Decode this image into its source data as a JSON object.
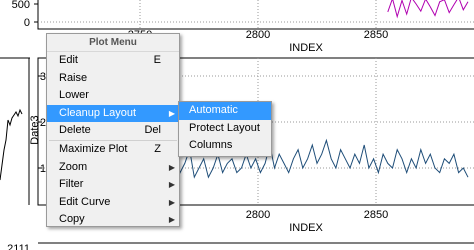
{
  "plots": {
    "top": {
      "y_ticks": [
        "500",
        "0"
      ],
      "x_ticks": [
        "2750",
        "2800",
        "2850"
      ],
      "x_label": "INDEX"
    },
    "bottom": {
      "y_ticks": [
        "3",
        "2",
        "1"
      ],
      "y_label": "Date3",
      "x_ticks": [
        "2800",
        "2850"
      ],
      "x_label": "INDEX"
    },
    "bottom_edge_label": "2111"
  },
  "colors": {
    "top_series": "#b000b0",
    "bottom_series": "#1f4e79",
    "left_series": "#000000",
    "menu_highlight": "#3399ff"
  },
  "chart_data": [
    {
      "type": "line",
      "xlabel": "INDEX",
      "ylabel": "",
      "ylim": [
        0,
        700
      ],
      "x_ticks": [
        2750,
        2800,
        2850
      ],
      "series": [
        {
          "x": [
            2855,
            2857,
            2859,
            2861,
            2863,
            2865,
            2867,
            2869,
            2871,
            2873,
            2875,
            2877,
            2879,
            2881,
            2883,
            2885,
            2887,
            2889
          ],
          "values": [
            280,
            650,
            150,
            600,
            220,
            680,
            500,
            300,
            640,
            420,
            180,
            560,
            620,
            260,
            480,
            690,
            340,
            560
          ]
        }
      ],
      "grid": true
    },
    {
      "type": "line",
      "xlabel": "INDEX",
      "ylabel": "Date3",
      "ylim": [
        0.5,
        3.5
      ],
      "x_ticks": [
        2800,
        2850
      ],
      "series": [
        {
          "x": [
            2753,
            2755,
            2757,
            2759,
            2761,
            2763,
            2765,
            2767,
            2769,
            2771,
            2773,
            2775,
            2777,
            2779,
            2781,
            2783,
            2785,
            2787,
            2789,
            2791,
            2793,
            2795,
            2797,
            2799,
            2801,
            2803,
            2805,
            2807,
            2809,
            2811,
            2813,
            2815,
            2817,
            2819,
            2821,
            2823,
            2825,
            2827,
            2829,
            2831,
            2833,
            2835,
            2837,
            2839,
            2841,
            2843,
            2845,
            2847,
            2849,
            2851,
            2853,
            2855,
            2857,
            2859,
            2861,
            2863,
            2865,
            2867,
            2869,
            2871,
            2873,
            2875,
            2877,
            2879,
            2881,
            2883,
            2885,
            2887,
            2889
          ],
          "values": [
            1.1,
            0.9,
            1.0,
            1.3,
            0.8,
            1.0,
            1.2,
            0.9,
            1.1,
            1.4,
            0.8,
            1.0,
            1.2,
            0.8,
            1.0,
            1.3,
            0.9,
            1.1,
            1.2,
            0.9,
            1.0,
            1.3,
            1.0,
            1.2,
            0.9,
            1.1,
            1.5,
            1.0,
            1.3,
            1.1,
            0.9,
            1.2,
            1.4,
            1.0,
            1.2,
            1.5,
            1.1,
            1.3,
            1.6,
            1.2,
            1.0,
            1.4,
            1.2,
            1.0,
            1.3,
            1.1,
            1.5,
            1.0,
            1.2,
            0.9,
            1.3,
            1.1,
            1.0,
            1.4,
            1.2,
            0.9,
            1.2,
            1.0,
            1.4,
            1.1,
            1.3,
            1.0,
            0.9,
            1.2,
            1.1,
            1.3,
            0.9,
            1.0,
            0.8
          ]
        }
      ],
      "grid": true
    }
  ],
  "menu": {
    "title": "Plot Menu",
    "items": [
      {
        "label": "Edit",
        "shortcut": "E"
      },
      {
        "label": "Raise",
        "shortcut": ""
      },
      {
        "label": "Lower",
        "shortcut": ""
      },
      {
        "label": "Cleanup Layout",
        "shortcut": ""
      },
      {
        "label": "Delete",
        "shortcut": "Del"
      },
      {
        "label": "Maximize Plot",
        "shortcut": "Z"
      },
      {
        "label": "Zoom",
        "shortcut": ""
      },
      {
        "label": "Filter",
        "shortcut": ""
      },
      {
        "label": "Edit Curve",
        "shortcut": ""
      },
      {
        "label": "Copy",
        "shortcut": ""
      }
    ],
    "submenu": {
      "items": [
        "Automatic",
        "Protect Layout",
        "Columns"
      ]
    }
  }
}
